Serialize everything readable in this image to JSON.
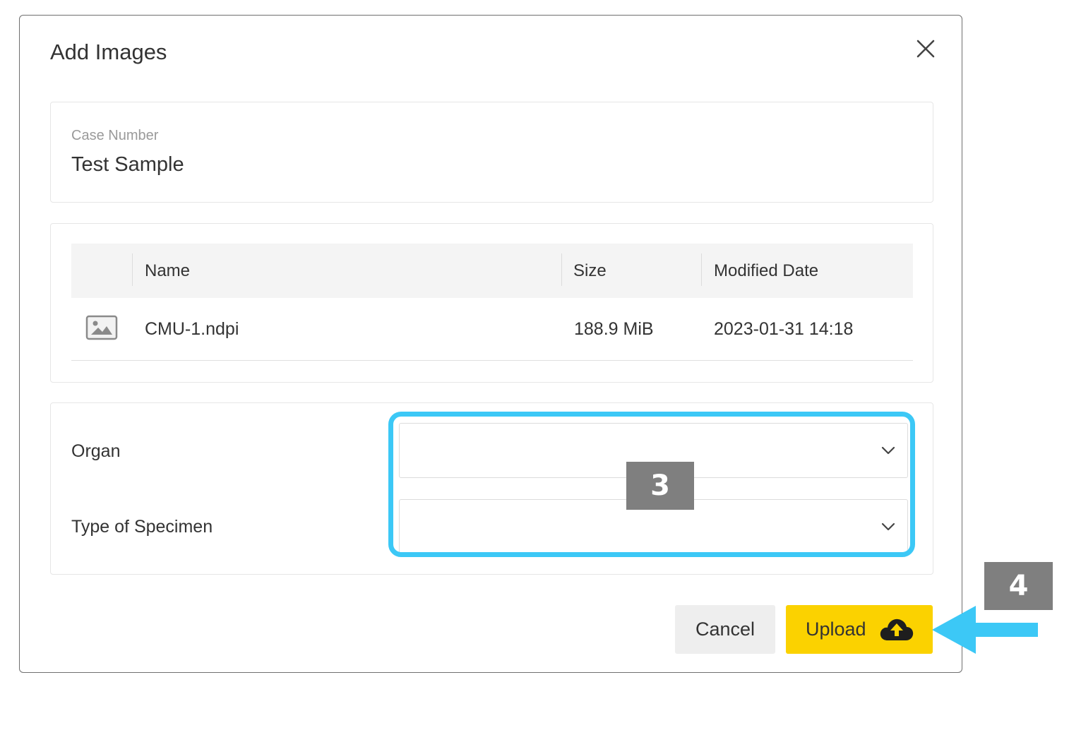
{
  "dialog": {
    "title": "Add Images"
  },
  "case": {
    "label": "Case Number",
    "value": "Test Sample"
  },
  "files_table": {
    "columns": [
      "Name",
      "Size",
      "Modified Date"
    ],
    "rows": [
      {
        "icon": "image-file-icon",
        "name": "CMU-1.ndpi",
        "size": "188.9 MiB",
        "modified": "2023-01-31 14:18"
      }
    ]
  },
  "fields": {
    "organ_label": "Organ",
    "organ_value": "",
    "specimen_label": "Type of Specimen",
    "specimen_value": ""
  },
  "buttons": {
    "cancel_label": "Cancel",
    "upload_label": "Upload",
    "upload_icon": "cloud-upload-icon"
  },
  "annotations": {
    "step_3": "3",
    "step_4": "4",
    "highlight_color": "#3cc8f6",
    "badge_color": "#7f7f7f"
  },
  "colors": {
    "upload_button": "#fbd200",
    "cancel_button": "#eeeeee"
  }
}
